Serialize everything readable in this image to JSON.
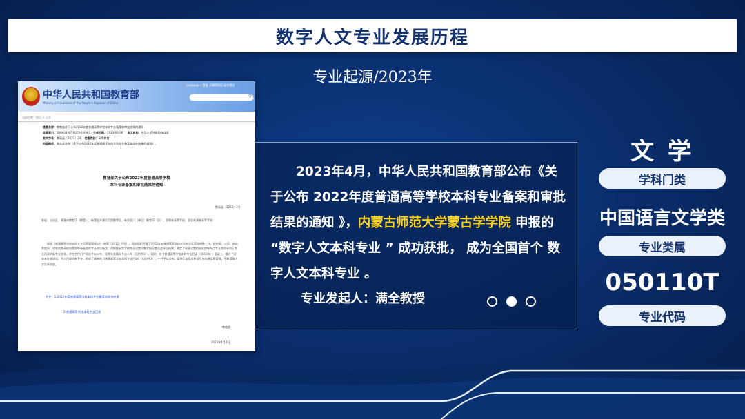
{
  "banner": {
    "title": "数字人文专业发展历程"
  },
  "subtitle": "专业起源/2023年",
  "document": {
    "ministry_name": "中华人民共和国教育部",
    "ministry_en": "Ministry of Education of the People's Republic of China",
    "top_links": "Language  |  登录  无障碍阅读  适老模式",
    "breadcrumb": "当前位置：首页  >  公开",
    "meta": {
      "index_label": "信息名称：",
      "index_value": "教育部关于公布2022年度普通高等学校本科专业备案和审批结果的通知",
      "code_label": "信息索引：",
      "code_value": "360A08-07-2023-0004-1",
      "date_label": "生成日期：",
      "date_value": "2023-04-06",
      "issuer_label": "发文机构：",
      "issuer_value": "中华人民共和国教育部",
      "docno_label": "发文字号：",
      "docno_value": "教高函〔2023〕3号",
      "category_label": "信息类别：",
      "category_value": "高等教育",
      "summary_label": "内容概述：",
      "summary_value": "教育部发布《关于公布2022年度普通高等学校本科专业备案和审批结果的通知》。"
    },
    "title_line1": "教育部关于公布2022年度普通高等学校",
    "title_line2": "本科专业备案和审批结果的通知",
    "doc_number": "教高函〔2023〕3号",
    "addressee": "各省、自治区、直辖市教育厅（教委），新疆生产建设兵团教育局，有关部门（单位）教育司（局），部属各高等学校、部省合建各高等学校：",
    "body": "根据《普通高等学校本科专业设置管理规定》（教高〔2012〕9号），我部组织开展了2022年度普通高等学校本科专业设置和调整工作。经申报、公示、审核等程序，对各地各高校向我部申请备案的专业予以备案；对根据高等学校专业设置与教学指导委员会评议结果，确定了同意设置的国家控制布点专业和尚未列入专业目录的新专业名单，并在工作门户网站予以公布，现将有关情况予以公布（见附件1）。同时，在《普通高等学校本科专业目录（2012年）》基础上，增补了近年来批准增设、列入目录的新专业，形成了最新的《普通高等学校本科专业目录》（见附件2），一并予以公布。请你们加强对新设专业的建设和管理，不断提高人才培养质量。",
    "attachment1": "附件：1.2022年度普通高等学校本科专业备案和审批结果",
    "attachment2": "2.普通高等学校本科专业目录",
    "signature": "教育部",
    "sign_date": "2023年4月4日"
  },
  "main_text": {
    "part1": "2023年4月，中华人民共和国教育部公布《关于公布 2022年度普通高等学校本科专业备案和审批结果的通知 》，",
    "highlight": "内蒙古师范大学蒙古学学院",
    "part2": " 申报的 “数字人文本科专业 ” 成功获批， 成为全国首个 数字人文本科专业 。",
    "initiator": "专业发起人：满全教授"
  },
  "carousel": {
    "count": 3,
    "active_index": 1
  },
  "side": {
    "discipline": "文 学",
    "discipline_label": "学科门类",
    "category": "中国语言文学类",
    "category_label": "专业类属",
    "code": "050110T",
    "code_label": "专业代码"
  },
  "colors": {
    "background": "#0a2f6e",
    "banner_text": "#14326e",
    "highlight": "#ffd21e",
    "pill": "#eaf1fa"
  }
}
